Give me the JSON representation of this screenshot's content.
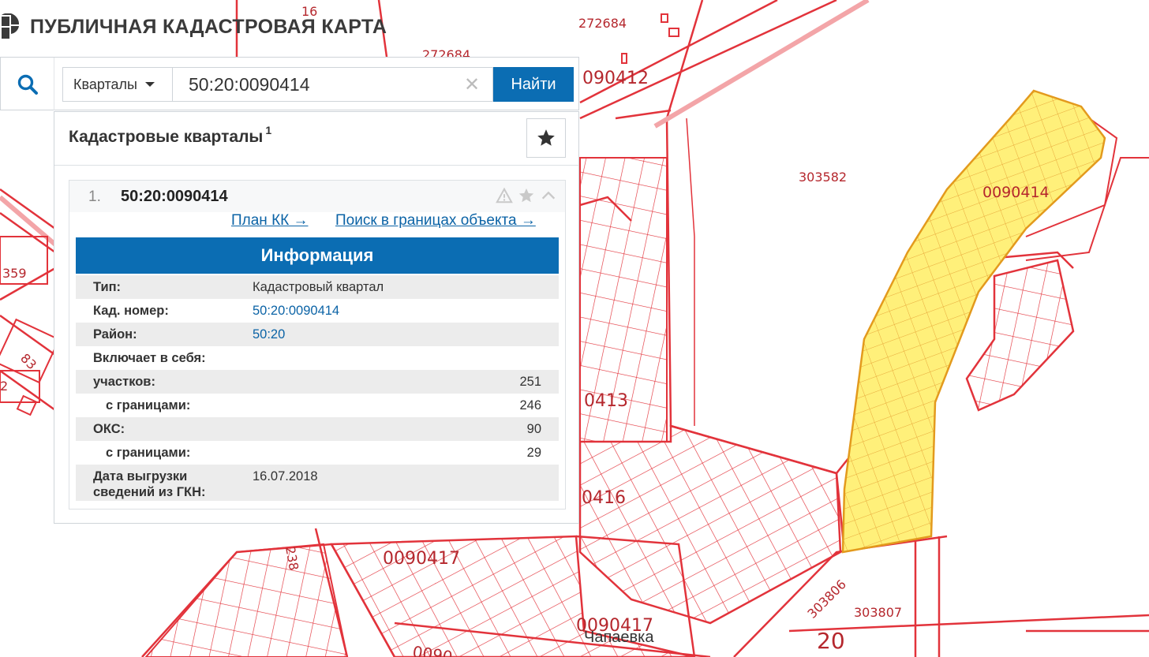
{
  "app": {
    "title": "ПУБЛИЧНАЯ КАДАСТРОВАЯ КАРТА"
  },
  "search": {
    "type_selected": "Кварталы",
    "query": "50:20:0090414",
    "find_label": "Найти"
  },
  "panel": {
    "title": "Кадастровые кварталы",
    "count": "1",
    "result": {
      "index": "1.",
      "id": "50:20:0090414",
      "link_plan": "План КК →",
      "link_search": "Поиск в границах объекта →",
      "info_title": "Информация",
      "rows": {
        "type": {
          "label": "Тип:",
          "value": "Кадастровый квартал"
        },
        "cad_number": {
          "label": "Кад. номер:",
          "value": "50:20:0090414"
        },
        "district": {
          "label": "Район:",
          "value": "50:20"
        },
        "includes": {
          "label": "Включает в себя:"
        },
        "parcels": {
          "label": "участков:",
          "value": "251"
        },
        "parcels_bounded": {
          "label": "с границами:",
          "value": "246"
        },
        "oks": {
          "label": "ОКС:",
          "value": "90"
        },
        "oks_bounded": {
          "label": "с границами:",
          "value": "29"
        },
        "export_date": {
          "label_1": "Дата выгрузки",
          "label_2": "сведений из ГКН:",
          "value": "16.07.2018"
        }
      }
    }
  },
  "map": {
    "labels": {
      "l16": "16",
      "l272684a": "272684",
      "l272684b": "272684",
      "l0412": "090412",
      "l303582": "303582",
      "l0414": "0090414",
      "l359": "359",
      "l83": "83",
      "l2": "2",
      "l0413": "0413",
      "l0416": "0416",
      "l238": "238",
      "l0417a": "0090417",
      "l0417b": "0090417",
      "l0901": "0090",
      "l303806": "303806",
      "l303807": "303807",
      "l20": "20",
      "chapaevka": "Чапаевка"
    }
  },
  "colors": {
    "accent": "#0b6db3",
    "map_line": "#e2333b",
    "selected_fill": "#fff07a",
    "selected_stroke": "#e39a1d"
  }
}
